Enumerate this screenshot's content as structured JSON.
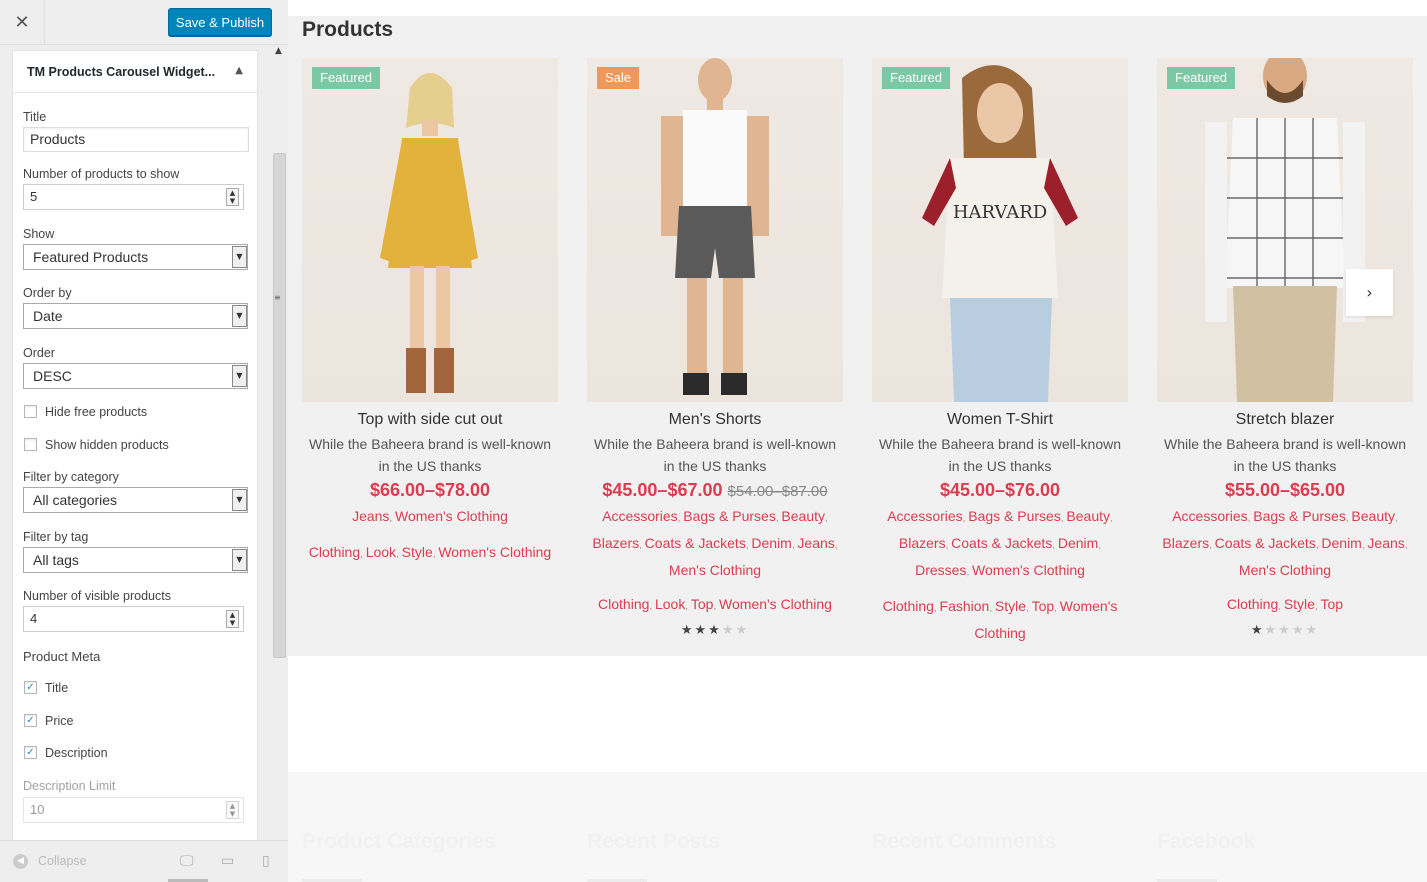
{
  "sidebar": {
    "close_icon": "close-icon",
    "save_label": "Save & Publish",
    "widget_title": "TM Products Carousel Widget...",
    "fields": {
      "title_label": "Title",
      "title_value": "Products",
      "num_products_label": "Number of products to show",
      "num_products_value": "5",
      "show_label": "Show",
      "show_value": "Featured Products",
      "orderby_label": "Order by",
      "orderby_value": "Date",
      "order_label": "Order",
      "order_value": "DESC",
      "hide_free_label": "Hide free products",
      "show_hidden_label": "Show hidden products",
      "filter_cat_label": "Filter by category",
      "filter_cat_value": "All categories",
      "filter_tag_label": "Filter by tag",
      "filter_tag_value": "All tags",
      "visible_label": "Number of visible products",
      "visible_value": "4",
      "meta_label": "Product Meta",
      "meta_title": "Title",
      "meta_price": "Price",
      "meta_desc": "Description",
      "desc_limit_label": "Description Limit",
      "desc_limit_value": "10"
    },
    "checks": {
      "hide_free": false,
      "show_hidden": false,
      "meta_title": true,
      "meta_price": true,
      "meta_desc": true
    },
    "collapse_label": "Collapse",
    "devices": [
      "desktop-icon",
      "tablet-icon",
      "mobile-icon"
    ]
  },
  "preview": {
    "section_title": "Products",
    "products": [
      {
        "badge": "Featured",
        "name": "Top with side cut out",
        "desc": "While the Baheera brand is well-known in the US thanks",
        "price": "$66.00–$78.00",
        "old_price": "",
        "categories": [
          "Jeans",
          "Women's Clothing"
        ],
        "tags": [
          "Clothing",
          "Look",
          "Style",
          "Women's Clothing"
        ],
        "rating": 0
      },
      {
        "badge": "Sale",
        "name": "Men's Shorts",
        "desc": "While the Baheera brand is well-known in the US thanks",
        "price": "$45.00–$67.00",
        "old_price": "$54.00–$87.00",
        "categories": [
          "Accessories",
          "Bags & Purses",
          "Beauty",
          "Blazers",
          "Coats & Jackets",
          "Denim",
          "Jeans",
          "Men's Clothing"
        ],
        "tags": [
          "Clothing",
          "Look",
          "Top",
          "Women's Clothing"
        ],
        "rating": 3
      },
      {
        "badge": "Featured",
        "name": "Women T-Shirt",
        "desc": "While the Baheera brand is well-known in the US thanks",
        "price": "$45.00–$76.00",
        "old_price": "",
        "categories": [
          "Accessories",
          "Bags & Purses",
          "Beauty",
          "Blazers",
          "Coats & Jackets",
          "Denim",
          "Dresses",
          "Women's Clothing"
        ],
        "tags": [
          "Clothing",
          "Fashion",
          "Style",
          "Top",
          "Women's Clothing"
        ],
        "rating": 0
      },
      {
        "badge": "Featured",
        "name": "Stretch blazer",
        "desc": "While the Baheera brand is well-known in the US thanks",
        "price": "$55.00–$65.00",
        "old_price": "",
        "categories": [
          "Accessories",
          "Bags & Purses",
          "Beauty",
          "Blazers",
          "Coats & Jackets",
          "Denim",
          "Jeans",
          "Men's Clothing"
        ],
        "tags": [
          "Clothing",
          "Style",
          "Top"
        ],
        "rating": 1
      }
    ],
    "footer_headings": [
      "Product Categories",
      "Recent Posts",
      "Recent Comments",
      "Facebook"
    ],
    "colors": {
      "accent": "#dd3c50",
      "featured": "#7bc8a4",
      "sale": "#f0975a",
      "button": "#0085ba"
    }
  }
}
